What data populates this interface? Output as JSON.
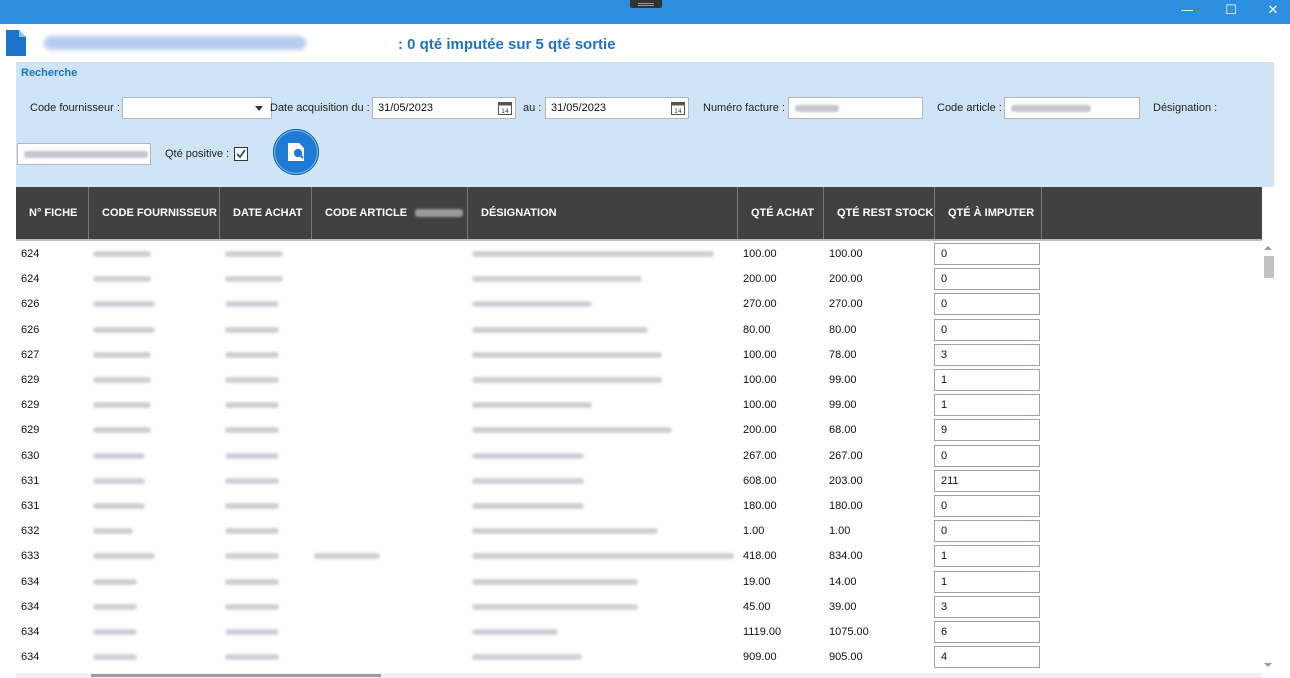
{
  "window": {
    "minimize_glyph": "—",
    "maximize_glyph": "☐",
    "close_glyph": "✕"
  },
  "header": {
    "summary": ": 0 qté imputée sur 5 qté sortie"
  },
  "search": {
    "title": "Recherche",
    "supplier_label": "Code fournisseur :",
    "supplier_value": "",
    "date_from_label": "Date acquisition du :",
    "date_from": "31/05/2023",
    "date_to_label": "au :",
    "date_to": "31/05/2023",
    "invoice_label": "Numéro facture :",
    "article_label": "Code article :",
    "designation_label": "Désignation :",
    "positive_label": "Qté positive :",
    "positive_checked": true,
    "check_glyph": "✔"
  },
  "table": {
    "columns": [
      "N° FICHE",
      "CODE FOURNISSEUR",
      "DATE ACHAT",
      "CODE ARTICLE",
      "DÉSIGNATION",
      "QTÉ ACHAT",
      "QTÉ REST STOCK",
      "QTÉ À IMPUTER"
    ],
    "rows": [
      {
        "fiche": "624",
        "achat": "100.00",
        "rest": "100.00",
        "imputer": "0"
      },
      {
        "fiche": "624",
        "achat": "200.00",
        "rest": "200.00",
        "imputer": "0"
      },
      {
        "fiche": "626",
        "achat": "270.00",
        "rest": "270.00",
        "imputer": "0"
      },
      {
        "fiche": "626",
        "achat": "80.00",
        "rest": "80.00",
        "imputer": "0"
      },
      {
        "fiche": "627",
        "achat": "100.00",
        "rest": "78.00",
        "imputer": "3"
      },
      {
        "fiche": "629",
        "achat": "100.00",
        "rest": "99.00",
        "imputer": "1"
      },
      {
        "fiche": "629",
        "achat": "100.00",
        "rest": "99.00",
        "imputer": "1"
      },
      {
        "fiche": "629",
        "achat": "200.00",
        "rest": "68.00",
        "imputer": "9"
      },
      {
        "fiche": "630",
        "achat": "267.00",
        "rest": "267.00",
        "imputer": "0"
      },
      {
        "fiche": "631",
        "achat": "608.00",
        "rest": "203.00",
        "imputer": "211"
      },
      {
        "fiche": "631",
        "achat": "180.00",
        "rest": "180.00",
        "imputer": "0"
      },
      {
        "fiche": "632",
        "achat": "1.00",
        "rest": "1.00",
        "imputer": "0"
      },
      {
        "fiche": "633",
        "achat": "418.00",
        "rest": "834.00",
        "imputer": "1"
      },
      {
        "fiche": "634",
        "achat": "19.00",
        "rest": "14.00",
        "imputer": "1"
      },
      {
        "fiche": "634",
        "achat": "45.00",
        "rest": "39.00",
        "imputer": "3"
      },
      {
        "fiche": "634",
        "achat": "1119.00",
        "rest": "1075.00",
        "imputer": "6"
      },
      {
        "fiche": "634",
        "achat": "909.00",
        "rest": "905.00",
        "imputer": "4"
      }
    ]
  },
  "colors": {
    "accent": "#2d8fe0",
    "title_text": "#1b74c8",
    "search_bg": "#cfe4f7",
    "header_bg": "#414141"
  }
}
